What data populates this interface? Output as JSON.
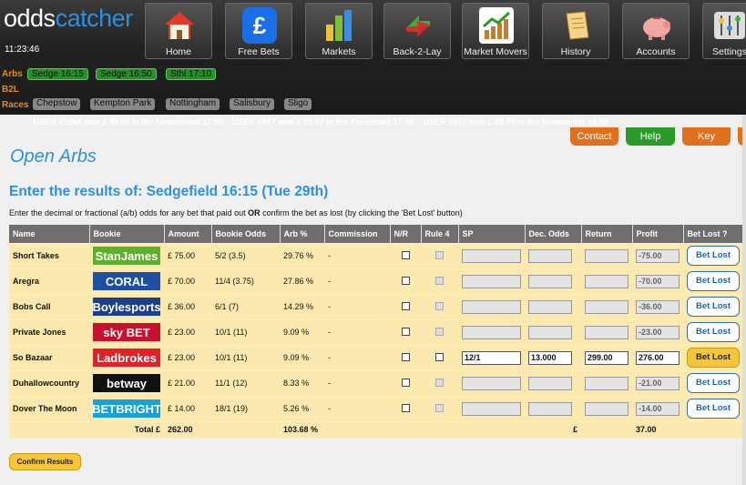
{
  "header": {
    "logo_part1": "odds",
    "logo_part2": "catcher",
    "clock": "11:23:46",
    "nav": [
      {
        "label": "Home",
        "icon": "house-icon"
      },
      {
        "label": "Free Bets",
        "icon": "pound-icon"
      },
      {
        "label": "Markets",
        "icon": "bar-chart-icon"
      },
      {
        "label": "Back-2-Lay",
        "icon": "arrows-icon"
      },
      {
        "label": "Market Movers",
        "icon": "rising-chart-icon"
      },
      {
        "label": "History",
        "icon": "scroll-icon"
      },
      {
        "label": "Accounts",
        "icon": "piggy-bank-icon"
      },
      {
        "label": "Settings",
        "icon": "sliders-icon"
      }
    ]
  },
  "quickbar": {
    "arbs_label": "Arbs",
    "arbs": [
      "Sedge 16:15",
      "Sedge 16:50",
      "Sthl 17:10"
    ],
    "b2l_label": "B2L",
    "races_label": "Races",
    "races": [
      "Chepstow",
      "Kempton Park",
      "Nottingham",
      "Salisbury",
      "Sligo"
    ]
  },
  "ticker": [
    "USER #1364 won £ 46.00 in the Newmarket 17:55",
    "USER #977 won £ 59.07 in the Pontefract 17:40",
    "USER #977 won £ 60.59 in the Newmarket 16:50"
  ],
  "top_buttons": {
    "contact": "Contact",
    "help": "Help",
    "key": "Key"
  },
  "page_title": "Open Arbs",
  "subtitle": "Enter the results of: Sedgefield 16:15 (Tue 29th)",
  "instructions": {
    "before": "Enter the decimal or fractional (a/b) odds for any bet that paid out ",
    "bold": "OR",
    "after": " confirm the bet as lost (by clicking the 'Bet Lost' button)"
  },
  "table": {
    "headers": [
      "Name",
      "Bookie",
      "Amount",
      "Bookie Odds",
      "Arb %",
      "Commission",
      "N/R",
      "Rule 4",
      "SP",
      "Dec. Odds",
      "Return",
      "Profit",
      "Bet Lost ?"
    ],
    "rows": [
      {
        "name": "Short Takes",
        "bookie": "StanJames",
        "amount": "£ 75.00",
        "odds": "5/2 (3.5)",
        "arb": "29.76 %",
        "commission": "-",
        "sp": "",
        "dec": "",
        "ret": "",
        "profit": "-75.00",
        "btn": "Bet Lost",
        "active": false
      },
      {
        "name": "Aregra",
        "bookie": "CORAL",
        "amount": "£ 70.00",
        "odds": "11/4 (3.75)",
        "arb": "27.86 %",
        "commission": "-",
        "sp": "",
        "dec": "",
        "ret": "",
        "profit": "-70.00",
        "btn": "Bet Lost",
        "active": false
      },
      {
        "name": "Bobs Call",
        "bookie": "Boylesports",
        "amount": "£ 36.00",
        "odds": "6/1 (7)",
        "arb": "14.29 %",
        "commission": "-",
        "sp": "",
        "dec": "",
        "ret": "",
        "profit": "-36.00",
        "btn": "Bet Lost",
        "active": false
      },
      {
        "name": "Private Jones",
        "bookie": "sky BET",
        "amount": "£ 23.00",
        "odds": "10/1 (11)",
        "arb": "9.09 %",
        "commission": "-",
        "sp": "",
        "dec": "",
        "ret": "",
        "profit": "-23.00",
        "btn": "Bet Lost",
        "active": false
      },
      {
        "name": "So Bazaar",
        "bookie": "Ladbrokes",
        "amount": "£ 23.00",
        "odds": "10/1 (11)",
        "arb": "9.09 %",
        "commission": "-",
        "sp": "12/1",
        "dec": "13.000",
        "ret": "299.00",
        "profit": "276.00",
        "btn": "Bet Lost",
        "active": true
      },
      {
        "name": "Duhallowcountry",
        "bookie": "betway",
        "amount": "£ 21.00",
        "odds": "11/1 (12)",
        "arb": "8.33 %",
        "commission": "-",
        "sp": "",
        "dec": "",
        "ret": "",
        "profit": "-21.00",
        "btn": "Bet Lost",
        "active": false
      },
      {
        "name": "Dover The Moon",
        "bookie": "BETBRIGHT",
        "amount": "£ 14.00",
        "odds": "18/1 (19)",
        "arb": "5.26 %",
        "commission": "-",
        "sp": "",
        "dec": "",
        "ret": "",
        "profit": "-14.00",
        "btn": "Bet Lost",
        "active": false
      }
    ],
    "total_label": "Total £",
    "total_amount": "262.00",
    "total_arb": "103.68 %",
    "total_profit_symbol": "£",
    "total_profit": "37.00"
  },
  "confirm_button": "Confirm Results",
  "colors": {
    "accent_blue": "#2e8fe0",
    "orange": "#e0701e",
    "green": "#2a9a2a",
    "row_bg": "#fbe9b0",
    "button_yellow": "#f5c63a"
  },
  "bookie_colors": {
    "StanJames": "#5fae2e",
    "CORAL": "#1e4fa0",
    "Boylesports": "#1d3e8a",
    "sky BET": "#c8102e",
    "Ladbrokes": "#e0202a",
    "betway": "#111111",
    "BETBRIGHT": "#1aa0d8"
  }
}
